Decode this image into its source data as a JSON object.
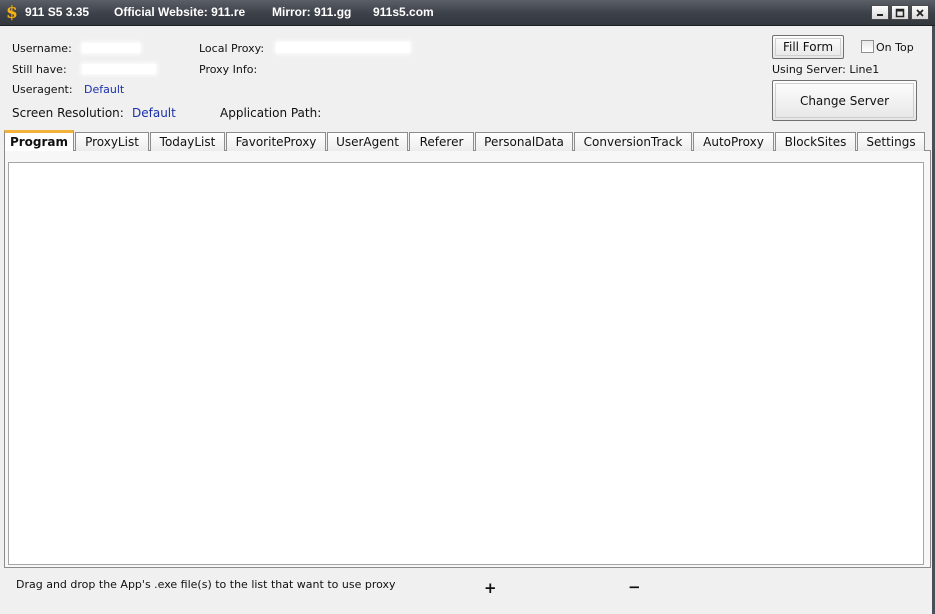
{
  "titlebar": {
    "app_icon": "dollar-icon",
    "app_name": "911 S5 3.35",
    "official_website": "Official Website:  911.re",
    "mirror": "Mirror:  911.gg",
    "alt_site": "911s5.com",
    "controls": [
      "minimize-icon",
      "maximize-icon",
      "close-icon"
    ]
  },
  "info": {
    "username_label": "Username:",
    "still_have_label": "Still have:",
    "useragent_label": "Useragent:",
    "useragent_value": "Default",
    "screen_resolution_label": "Screen Resolution:",
    "screen_resolution_value": "Default",
    "local_proxy_label": "Local Proxy:",
    "proxy_info_label": "Proxy Info:",
    "application_path_label": "Application Path:"
  },
  "actions": {
    "fill_form": "Fill Form",
    "on_top": "On Top",
    "on_top_checked": false,
    "using_server": "Using Server: Line1",
    "change_server": "Change Server"
  },
  "tabs": [
    {
      "label": "Program",
      "active": true
    },
    {
      "label": "ProxyList",
      "active": false
    },
    {
      "label": "TodayList",
      "active": false
    },
    {
      "label": "FavoriteProxy",
      "active": false
    },
    {
      "label": "UserAgent",
      "active": false
    },
    {
      "label": "Referer",
      "active": false
    },
    {
      "label": "PersonalData",
      "active": false
    },
    {
      "label": "ConversionTrack",
      "active": false
    },
    {
      "label": "AutoProxy",
      "active": false
    },
    {
      "label": "BlockSites",
      "active": false
    },
    {
      "label": "Settings",
      "active": false
    }
  ],
  "footer": {
    "hint": "Drag and drop the App's .exe file(s) to the list that want to use proxy",
    "add": "+",
    "remove": "−"
  },
  "colors": {
    "accent_tab": "#f2b13a",
    "value_blue": "#1a2fa8",
    "titlebar": "#3c4048"
  }
}
